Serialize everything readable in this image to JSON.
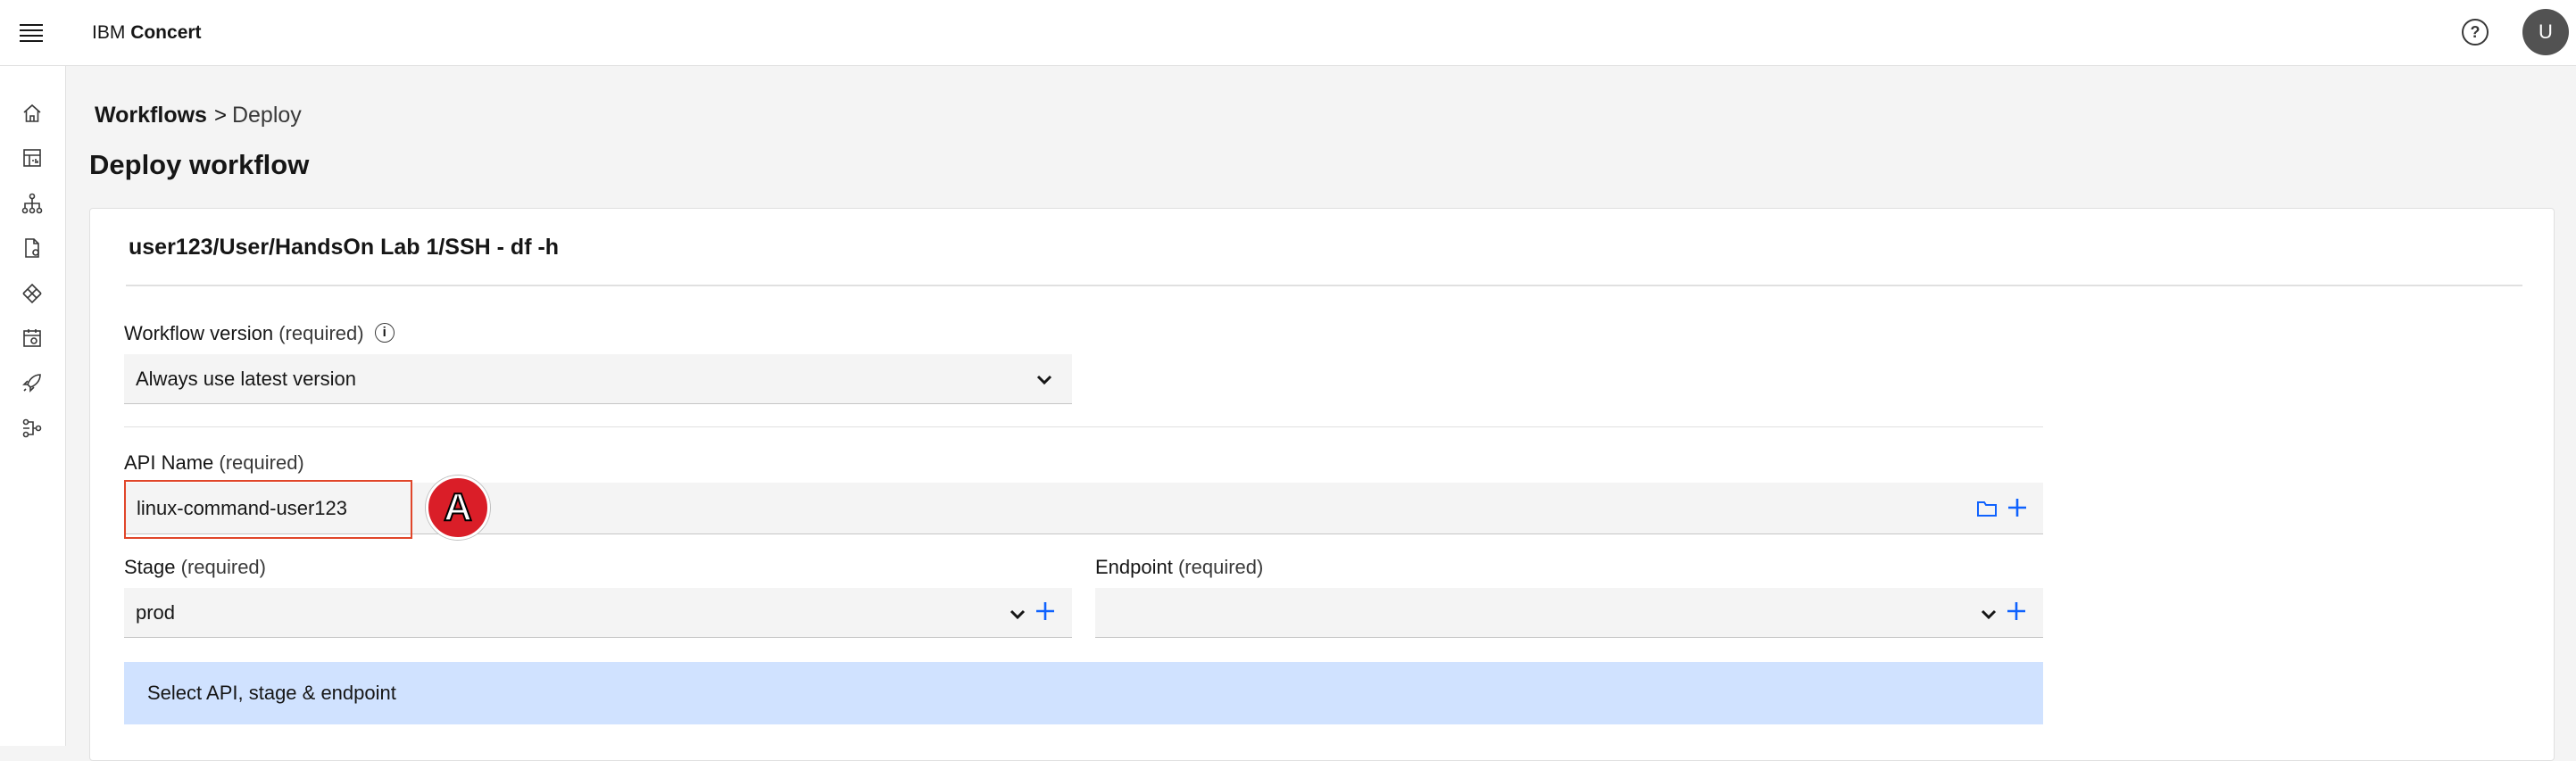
{
  "header": {
    "brand_prefix": "IBM",
    "brand_name": "Concert",
    "help_label": "?",
    "avatar_initial": "U"
  },
  "sidenav": {
    "items": [
      "home-icon",
      "dashboard-icon",
      "topology-icon",
      "document-icon",
      "resilience-icon",
      "calendar-icon",
      "rocket-icon",
      "workflow-icon"
    ]
  },
  "breadcrumb": {
    "parent": "Workflows",
    "separator": ">",
    "current": "Deploy"
  },
  "page": {
    "title": "Deploy workflow"
  },
  "card": {
    "title": "user123/User/HandsOn Lab 1/SSH - df -h",
    "workflow_version": {
      "label": "Workflow version",
      "required": "(required)",
      "info": "i",
      "value": "Always use latest version"
    },
    "api_name": {
      "label": "API Name",
      "required": "(required)",
      "value": "linux-command-user123"
    },
    "stage": {
      "label": "Stage",
      "required": "(required)",
      "value": "prod"
    },
    "endpoint": {
      "label": "Endpoint",
      "required": "(required)",
      "value": ""
    },
    "action_bar": "Select API, stage & endpoint"
  },
  "annotation": {
    "marker": "A"
  },
  "colors": {
    "accent": "#0f62fe",
    "highlight_border": "#e0462a",
    "marker_fill": "#da1e28",
    "action_bar_bg": "#d0e2ff"
  }
}
